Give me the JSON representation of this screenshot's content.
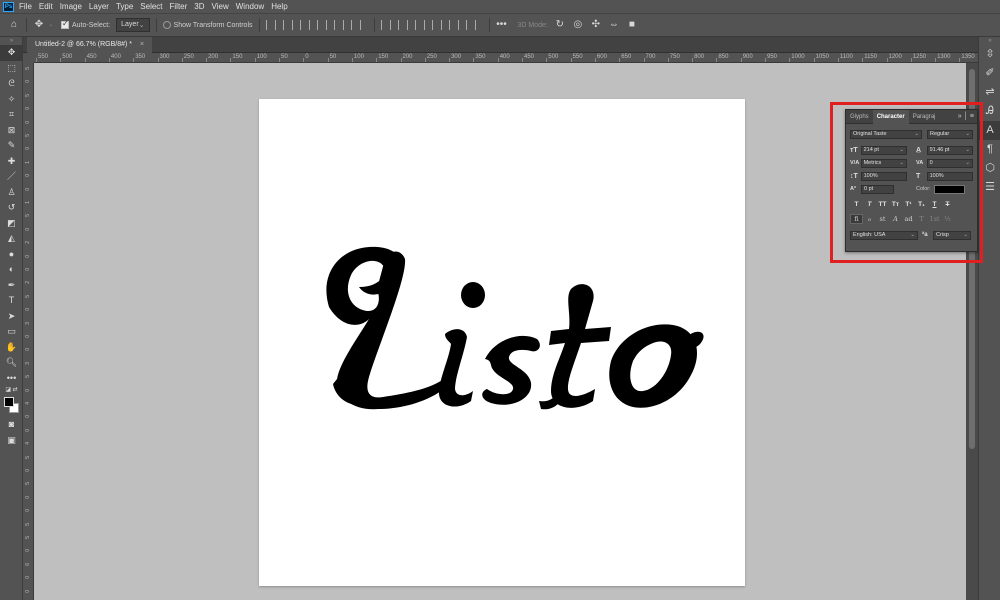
{
  "app": {
    "name": "Adobe Photoshop",
    "logo_text": "Ps"
  },
  "menu": [
    "File",
    "Edit",
    "Image",
    "Layer",
    "Type",
    "Select",
    "Filter",
    "3D",
    "View",
    "Window",
    "Help"
  ],
  "options_bar": {
    "auto_select_label": "Auto-Select:",
    "auto_select_checked": true,
    "auto_select_target": "Layer",
    "show_transform_label": "Show Transform Controls",
    "show_transform_checked": false,
    "mode_3d_label": "3D Mode:"
  },
  "document_tab": {
    "title": "Untitled-2 @ 66.7% (RGB/8#) *",
    "close": "×"
  },
  "rulers": {
    "horizontal": [
      "550",
      "500",
      "450",
      "400",
      "350",
      "300",
      "250",
      "200",
      "150",
      "100",
      "50",
      "0",
      "50",
      "100",
      "150",
      "200",
      "250",
      "300",
      "350",
      "400",
      "450",
      "500",
      "550",
      "600",
      "650",
      "700",
      "750",
      "800",
      "850",
      "900",
      "950",
      "1000",
      "1050",
      "1100",
      "1150",
      "1200",
      "1250",
      "1300",
      "1350"
    ],
    "vertical": [
      "5",
      "0",
      "5",
      "0",
      "0",
      "5",
      "0",
      "1",
      "0",
      "0",
      "1",
      "5",
      "0",
      "2",
      "0",
      "0",
      "2",
      "5",
      "0",
      "3",
      "0",
      "0",
      "3",
      "5",
      "0",
      "4",
      "0",
      "0",
      "4",
      "5",
      "0",
      "5",
      "0",
      "0",
      "5",
      "5",
      "0",
      "6",
      "0",
      "0"
    ]
  },
  "canvas": {
    "artwork_text": "Listo",
    "text_color": "#000000",
    "document_color": "#ffffff",
    "pasteboard_color": "#bfbfbf"
  },
  "character_panel": {
    "tabs": [
      "Glyphs",
      "Character",
      "Paragraj"
    ],
    "active_tab": "Character",
    "font_family": "Original Taste",
    "font_style": "Regular",
    "font_size": "214 pt",
    "leading": "91.46 pt",
    "kerning": "Metrics",
    "tracking": "0",
    "vertical_scale": "100%",
    "horizontal_scale": "100%",
    "baseline_shift": "0 pt",
    "color_label": "Color:",
    "color_value": "#000000",
    "type_style_buttons": [
      "T",
      "T",
      "TT",
      "Tт",
      "T¹",
      "T₁",
      "T",
      "T"
    ],
    "opentype_buttons": [
      "fi",
      "ℴ",
      "st",
      "A",
      "ad",
      "T",
      "1st",
      "½"
    ],
    "language": "English: USA",
    "aa_label": "ªa",
    "antialias": "Crisp"
  },
  "colors": {
    "highlight": "#e02020",
    "ui_bg": "#535353",
    "panel_dark": "#424242"
  }
}
